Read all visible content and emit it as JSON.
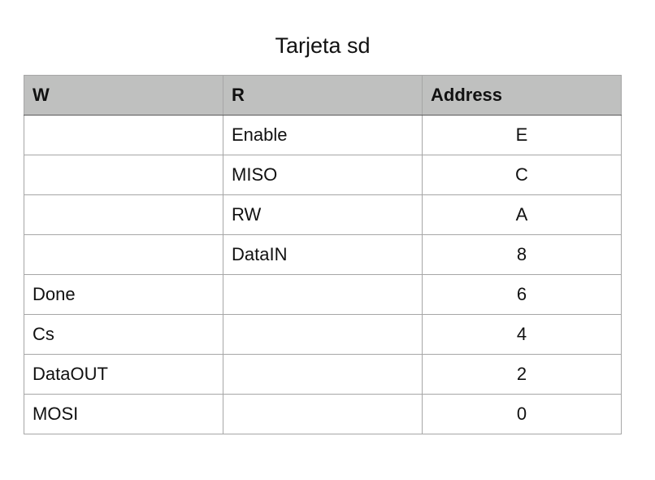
{
  "title": "Tarjeta sd",
  "headers": {
    "w": "W",
    "r": "R",
    "address": "Address"
  },
  "rows": [
    {
      "w": "",
      "r": "Enable",
      "address": "E"
    },
    {
      "w": "",
      "r": "MISO",
      "address": "C"
    },
    {
      "w": "",
      "r": "RW",
      "address": "A"
    },
    {
      "w": "",
      "r": "DataIN",
      "address": "8"
    },
    {
      "w": "Done",
      "r": "",
      "address": "6"
    },
    {
      "w": "Cs",
      "r": "",
      "address": "4"
    },
    {
      "w": "DataOUT",
      "r": "",
      "address": "2"
    },
    {
      "w": "MOSI",
      "r": "",
      "address": "0"
    }
  ],
  "colors": {
    "header_bg": "#bfc0bf",
    "grid": "#a6a6a6"
  }
}
